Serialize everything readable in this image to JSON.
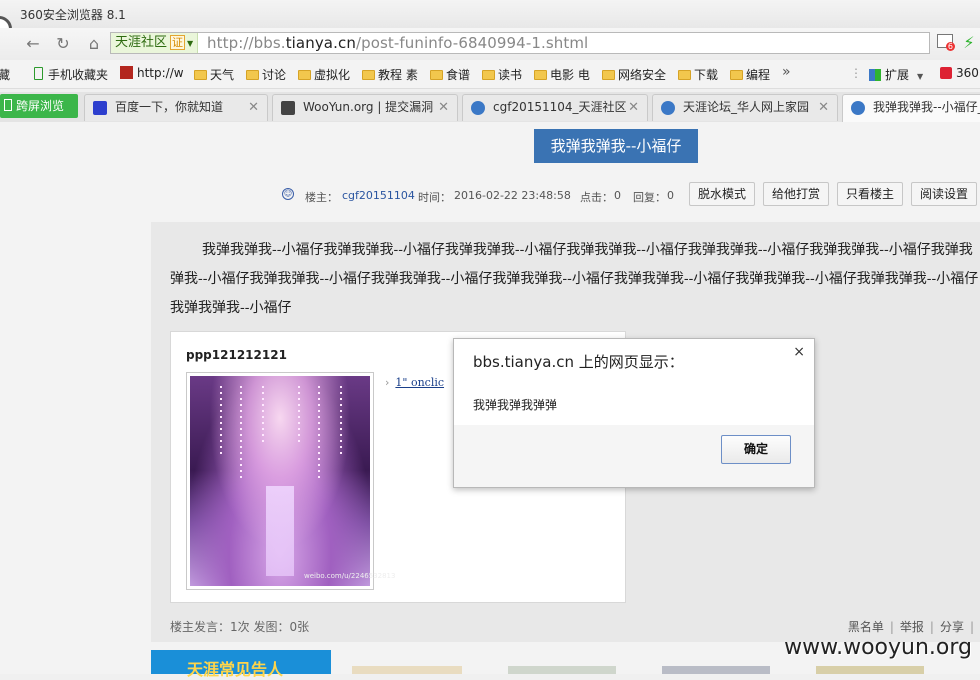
{
  "window": {
    "title": "360安全浏览器 8.1"
  },
  "address_bar": {
    "site_name": "天涯社区",
    "cert_label": "证",
    "url_prefix": "http://bbs.",
    "url_host": "tianya.cn",
    "url_path": "/post-funinfo-6840994-1.shtml",
    "notif_count": "6"
  },
  "bookmarks": {
    "cut_label": "藏",
    "items": [
      "手机收藏夹",
      "http://w",
      "天气",
      "讨论",
      "虚拟化",
      "教程 素",
      "食谱",
      "读书",
      "电影 电",
      "网络安全",
      "下载",
      "编程"
    ],
    "more": "»",
    "extend": "扩展",
    "extra": "360"
  },
  "tabs": {
    "split_view": "跨屏浏览",
    "items": [
      "百度一下，你就知道",
      "WooYun.org | 提交漏洞",
      "cgf20151104_天涯社区",
      "天涯论坛_华人网上家园",
      "我弹我弹我--小福仔_"
    ]
  },
  "post": {
    "title": "我弹我弹我--小福仔",
    "author_label": "楼主：",
    "author": "cgf20151104",
    "time_label": "时间：",
    "time": "2016-02-22 23:48:58",
    "clicks_label": "点击：",
    "clicks": "0",
    "replies_label": "回复：",
    "replies": "0",
    "toolbar": [
      "脱水模式",
      "给他打赏",
      "只看楼主",
      "阅读设置"
    ],
    "body": "我弹我弹我--小福仔我弹我弹我--小福仔我弹我弹我--小福仔我弹我弹我--小福仔我弹我弹我--小福仔我弹我弹我--小福仔我弹我弹我--小福仔我弹我弹我--小福仔我弹我弹我--小福仔我弹我弹我--小福仔我弹我弹我--小福仔我弹我弹我--小福仔我弹我弹我--小福仔我弹我弹我--小福仔",
    "card_name": "ppp121212121",
    "card_link": "1\" onclic",
    "photo_watermark": "weibo.com/u/2246532813",
    "stats": "楼主发言：1次 发图：0张",
    "actions": [
      "黑名单",
      "举报",
      "分享"
    ],
    "banner_text": "天涯常见告人"
  },
  "dialog": {
    "title": "bbs.tianya.cn 上的网页显示：",
    "message": "我弹我弹我弹弹",
    "ok_label": "确定",
    "close": "×"
  },
  "watermark": "www.wooyun.org"
}
